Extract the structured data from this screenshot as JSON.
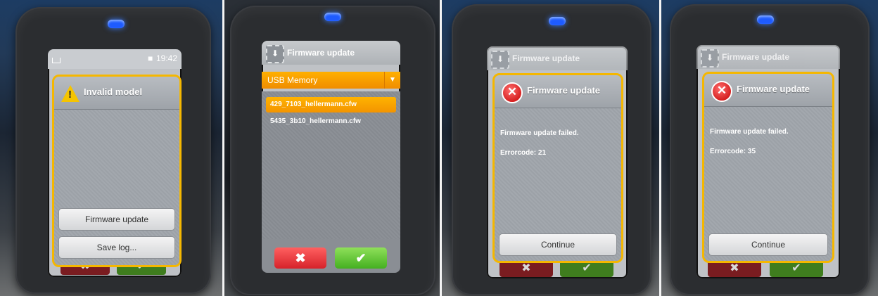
{
  "panel1": {
    "clock": "19:42",
    "dialog_title": "Invalid model",
    "buttons": [
      "Firmware update",
      "Save log..."
    ],
    "icons": {
      "dialog": "warning-icon",
      "status": "person-icon"
    }
  },
  "panel2": {
    "header_title": "Firmware update",
    "source": "USB Memory",
    "files": [
      "429_7103_hellermann.cfw",
      "5435_3b10_hellermann.cfw"
    ],
    "selected_file": "429_7103_hellermann.cfw",
    "cancel_symbol": "✖",
    "ok_symbol": "✔"
  },
  "panel3": {
    "background_title": "Firmware update",
    "dialog_title": "Firmware update",
    "message": "Firmware update failed.",
    "error": "Errorcode: 21",
    "button": "Continue"
  },
  "panel4": {
    "background_title": "Firmware update",
    "dialog_title": "Firmware update",
    "message": "Firmware update failed.",
    "error": "Errorcode: 35",
    "button": "Continue"
  },
  "colors": {
    "accent": "#f5b700",
    "error": "#d0161c",
    "ok": "#55c22a",
    "led": "#1e5bff"
  }
}
